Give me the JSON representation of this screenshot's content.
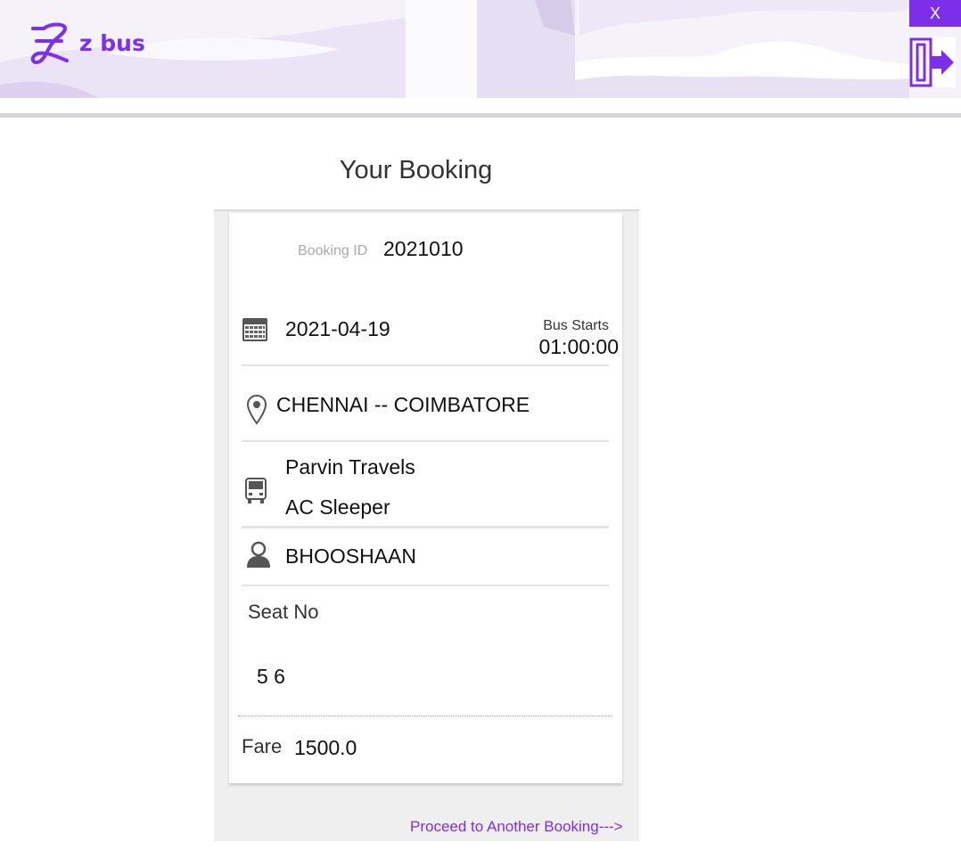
{
  "header": {
    "brand": "z bus",
    "close_label": "X",
    "brand_color": "#7b2ff0",
    "accent_color": "#7d2ee8"
  },
  "page": {
    "title": "Your Booking"
  },
  "booking": {
    "id_label": "Booking ID",
    "id_value": "2021010",
    "date": "2021-04-19",
    "starts_label": "Bus Starts",
    "start_time": "01:00:00",
    "route": "CHENNAI -- COIMBATORE",
    "operator": "Parvin Travels",
    "bus_type": "AC Sleeper",
    "passenger": "BHOOSHAAN",
    "seat_label": "Seat No",
    "seats": "5 6",
    "fare_label": "Fare",
    "fare": "1500.0"
  },
  "icons": {
    "logo": "zbus-logo-icon",
    "logout": "logout-icon",
    "calendar": "calendar-icon",
    "location": "map-pin-icon",
    "bus": "bus-icon",
    "user": "user-icon"
  },
  "footer": {
    "proceed_link": "Proceed to Another Booking--->"
  }
}
